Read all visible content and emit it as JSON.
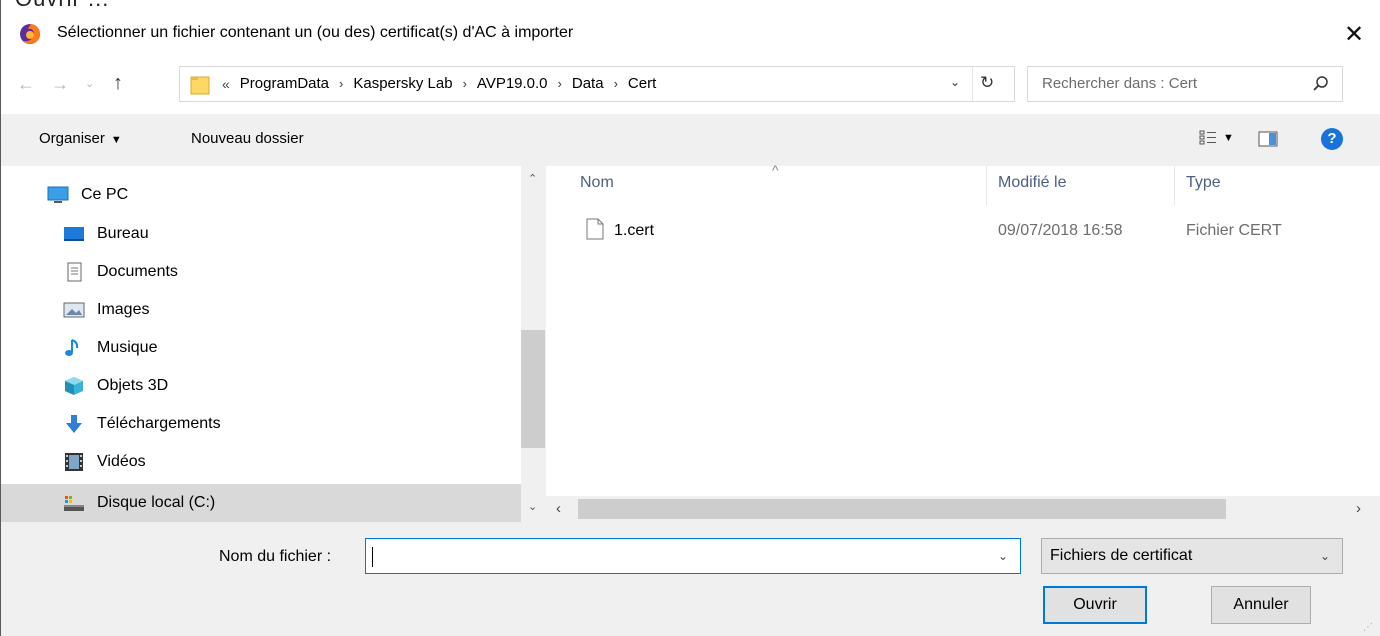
{
  "strip_text": "Ouvrir ...",
  "title": "Sélectionner un fichier contenant un (ou des) certificat(s) d'AC à importer",
  "close_label": "✕",
  "nav": {
    "back": "←",
    "forward": "→",
    "recent": "⌄",
    "up": "↑"
  },
  "address": {
    "overflow": "«",
    "crumbs": [
      "ProgramData",
      "Kaspersky Lab",
      "AVP19.0.0",
      "Data",
      "Cert"
    ],
    "separator": "›",
    "dropdown": "⌄",
    "refresh": "↻"
  },
  "search": {
    "placeholder": "Rechercher dans : Cert",
    "value": ""
  },
  "toolbar": {
    "organize_label": "Organiser",
    "organize_caret": "▼",
    "new_folder_label": "Nouveau dossier",
    "view_caret": "▼",
    "help_label": "?"
  },
  "sidebar": {
    "items": [
      {
        "label": "Ce PC",
        "icon": "computer-icon",
        "indent": 0,
        "selected": false
      },
      {
        "label": "Bureau",
        "icon": "desktop-icon",
        "indent": 1,
        "selected": false
      },
      {
        "label": "Documents",
        "icon": "documents-icon",
        "indent": 1,
        "selected": false
      },
      {
        "label": "Images",
        "icon": "images-icon",
        "indent": 1,
        "selected": false
      },
      {
        "label": "Musique",
        "icon": "music-icon",
        "indent": 1,
        "selected": false
      },
      {
        "label": "Objets 3D",
        "icon": "3d-objects-icon",
        "indent": 1,
        "selected": false
      },
      {
        "label": "Téléchargements",
        "icon": "downloads-icon",
        "indent": 1,
        "selected": false
      },
      {
        "label": "Vidéos",
        "icon": "videos-icon",
        "indent": 1,
        "selected": false
      },
      {
        "label": "Disque local (C:)",
        "icon": "local-disk-icon",
        "indent": 1,
        "selected": true
      }
    ],
    "scroll_up": "⌃",
    "scroll_down": "⌄"
  },
  "files": {
    "columns": {
      "name": "Nom",
      "modified": "Modifié le",
      "type": "Type"
    },
    "sort_arrow": "^",
    "rows": [
      {
        "name": "1.cert",
        "modified": "09/07/2018 16:58",
        "type": "Fichier CERT"
      }
    ],
    "hscroll_left": "‹",
    "hscroll_right": "›"
  },
  "footer": {
    "filename_label": "Nom du fichier :",
    "filename_value": "",
    "filename_dropdown": "⌄",
    "filter_value": "Fichiers de certificat",
    "filter_caret": "⌄",
    "open_label": "Ouvrir",
    "cancel_label": "Annuler"
  },
  "colors": {
    "accent": "#0078d7",
    "selected_bg": "#d9d9d9",
    "help_blue": "#1a73d9"
  }
}
